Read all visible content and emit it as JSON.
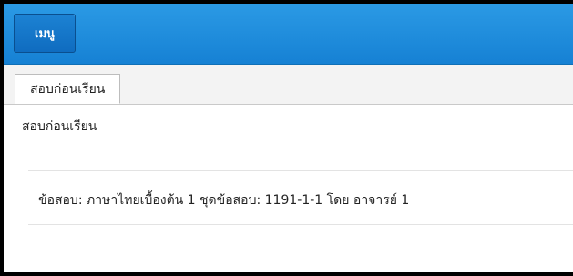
{
  "header": {
    "menu_label": "เมนู"
  },
  "tabs": [
    {
      "label": "สอบก่อนเรียน"
    }
  ],
  "main": {
    "section_title": "สอบก่อนเรียน",
    "exam_row": {
      "exam_label": "ข้อสอบ:",
      "exam_name": "ภาษาไทยเบื้องต้น 1",
      "set_label": "ชุดข้อสอบ:",
      "set_code": "1191-1-1",
      "by_label": "โดย",
      "teacher": "อาจารย์ 1"
    }
  },
  "colors": {
    "header_blue": "#1f8fde",
    "button_blue": "#0f6cc0"
  }
}
